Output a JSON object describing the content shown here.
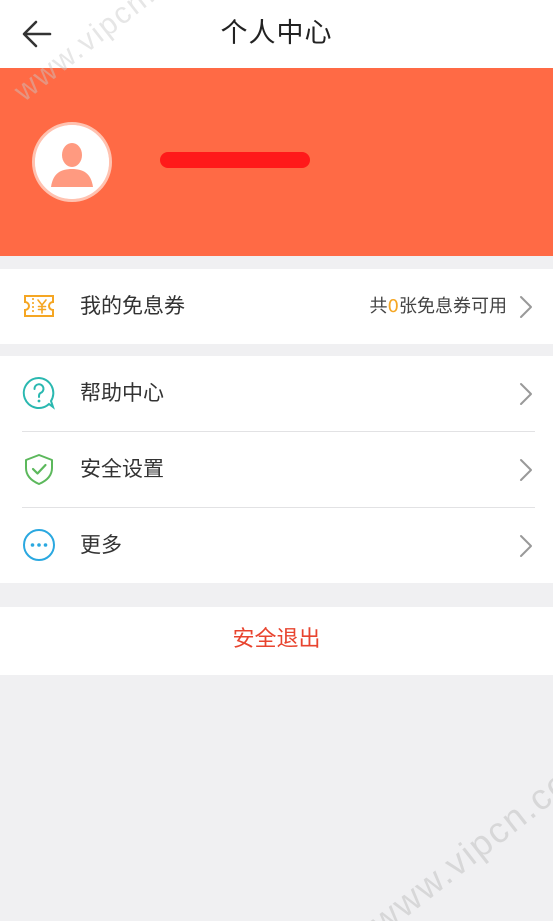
{
  "header": {
    "title": "个人中心",
    "back_icon": "arrow-left-icon"
  },
  "profile": {
    "avatar_icon": "user-silhouette-icon",
    "name_redacted": true
  },
  "coupon": {
    "label": "我的免息券",
    "icon": "coupon-yen-icon",
    "summary_prefix": "共",
    "summary_count": "0",
    "summary_suffix": "张免息券可用"
  },
  "menu": {
    "items": [
      {
        "label": "帮助中心",
        "icon": "question-circle-icon"
      },
      {
        "label": "安全设置",
        "icon": "shield-check-icon"
      },
      {
        "label": "更多",
        "icon": "more-dots-icon"
      }
    ]
  },
  "logout": {
    "label": "安全退出"
  },
  "watermark": {
    "text": "www.vipcn.com"
  },
  "colors": {
    "banner": "#ff6a45",
    "coupon_icon": "#f5a623",
    "help_icon": "#2ab8b0",
    "security_icon": "#5cb85c",
    "more_icon": "#2aa8e0",
    "logout_text": "#e8442f",
    "count_highlight": "#f5a623"
  }
}
